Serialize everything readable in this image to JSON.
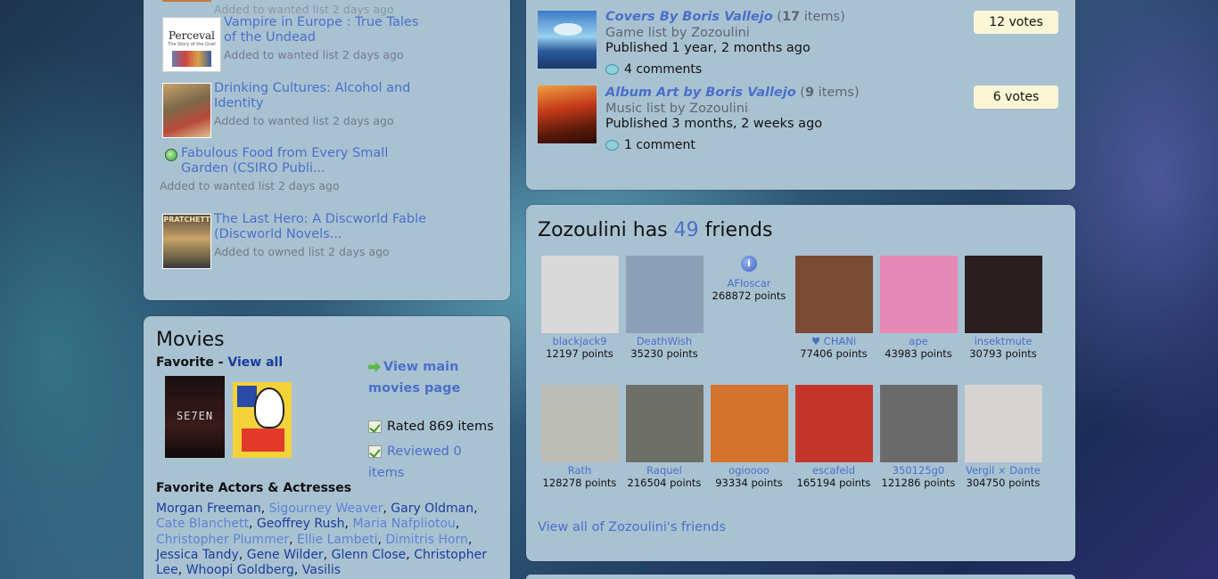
{
  "wanted": {
    "top_meta": "Added to wanted list 2 days ago",
    "items": [
      {
        "title": "Vampire in Europe : True Tales of the Undead",
        "meta": "Added to wanted list 2 days ago",
        "cover_title": "Perceval",
        "cover_sub": "The Story of the Grail"
      },
      {
        "title": "Drinking Cultures: Alcohol and Identity",
        "meta": "Added to wanted list 2 days ago"
      },
      {
        "title": "Fabulous Food from Every Small Garden (CSIRO Publi...",
        "meta": "Added to wanted list 2 days ago"
      },
      {
        "title": "The Last Hero: A Discworld Fable (Discworld Novels...",
        "meta": "Added to owned list 2 days ago",
        "cover_title": "PRATCHETT"
      }
    ]
  },
  "movies": {
    "heading": "Movies",
    "favorite_label": "Favorite",
    "favorite_sep": " - ",
    "view_all": "View all",
    "view_main": "View main movies page",
    "rated": "Rated 869 items",
    "reviewed": "Reviewed 0 items",
    "poster1_title": "SE7EN",
    "actors_heading": "Favorite Actors & Actresses",
    "actors": [
      {
        "name": "Morgan Freeman",
        "style": "dark"
      },
      {
        "name": "Sigourney Weaver",
        "style": "light"
      },
      {
        "name": "Gary Oldman",
        "style": "dark"
      },
      {
        "name": "Cate Blanchett",
        "style": "light"
      },
      {
        "name": "Geoffrey Rush",
        "style": "dark"
      },
      {
        "name": "Maria Nafpliotou",
        "style": "light"
      },
      {
        "name": "Christopher Plummer",
        "style": "light"
      },
      {
        "name": "Ellie Lambeti",
        "style": "light"
      },
      {
        "name": "Dimitris Horn",
        "style": "light"
      },
      {
        "name": "Jessica Tandy",
        "style": "dark"
      },
      {
        "name": "Gene Wilder",
        "style": "dark"
      },
      {
        "name": "Glenn Close",
        "style": "dark"
      },
      {
        "name": "Christopher Lee",
        "style": "dark"
      },
      {
        "name": "Whoopi Goldberg",
        "style": "dark"
      },
      {
        "name": "Vasilis",
        "style": "dark"
      }
    ]
  },
  "lists": [
    {
      "title": "Covers By Boris Vallejo",
      "count_open": " (",
      "count": "17",
      "count_close": " items)",
      "type": "Game list by Zozoulini",
      "published": "Published 1 year, 2 months ago",
      "comments": "4 comments",
      "votes": "12 votes"
    },
    {
      "title": "Album Art by Boris Vallejo",
      "count_open": " (",
      "count": "9",
      "count_close": " items)",
      "type": "Music list by Zozoulini",
      "published": "Published 3 months, 2 weeks ago",
      "comments": "1 comment",
      "votes": "6 votes"
    }
  ],
  "friends": {
    "heading_pre": "Zozoulini has ",
    "count": "49",
    "heading_post": " friends",
    "view_all": "View all of Zozoulini's friends",
    "people": [
      {
        "name": "blackjack9",
        "points": "12197 points",
        "color": "#d9d9d9"
      },
      {
        "name": "DeathWish",
        "points": "35230 points",
        "color": "#8ea0b8"
      },
      {
        "name": "AFIoscar",
        "points": "268872 points",
        "color": ""
      },
      {
        "name": "♥ CHANi",
        "points": "77406 points",
        "color": "#7a4a32"
      },
      {
        "name": "ape",
        "points": "43983 points",
        "color": "#e58ab6"
      },
      {
        "name": "insektmute",
        "points": "30793 points",
        "color": "#2b1e1e"
      },
      {
        "name": "Rath",
        "points": "128278 points",
        "color": "#bdbdb8"
      },
      {
        "name": "Raquel",
        "points": "216504 points",
        "color": "#6e7068"
      },
      {
        "name": "ogioooo",
        "points": "93334 points",
        "color": "#d3722c"
      },
      {
        "name": "escafeld",
        "points": "165194 points",
        "color": "#c2362b"
      },
      {
        "name": "350125g0",
        "points": "121286 points",
        "color": "#6a6a6a"
      },
      {
        "name": "Vergil × Dante",
        "points": "304750 points",
        "color": "#d7d3d0"
      }
    ]
  }
}
